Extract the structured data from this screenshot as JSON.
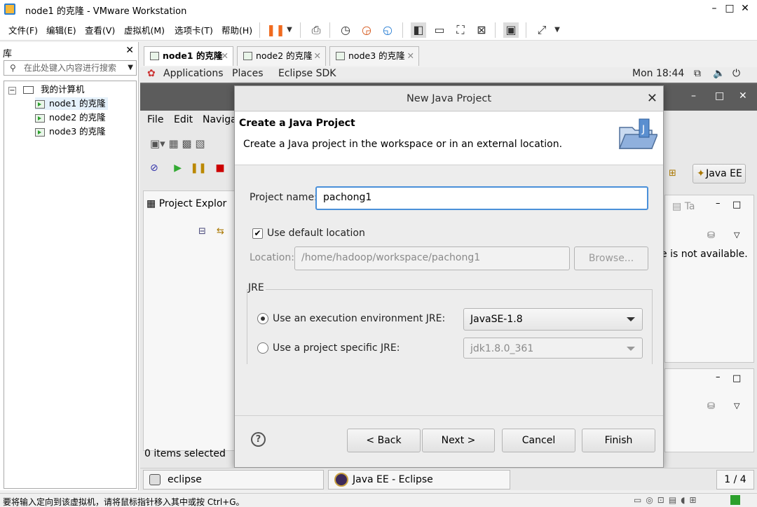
{
  "window": {
    "title": "node1 的克隆 - VMware Workstation",
    "controls": [
      "–",
      "□",
      "✕"
    ]
  },
  "menubar": {
    "items": [
      "文件(F)",
      "编辑(E)",
      "查看(V)",
      "虚拟机(M)",
      "选项卡(T)",
      "帮助(H)"
    ]
  },
  "library": {
    "title": "库",
    "close": "✕",
    "search_placeholder": "在此处键入内容进行搜索",
    "tree": {
      "root": "我的计算机",
      "items": [
        "node1 的克隆",
        "node2 的克隆",
        "node3 的克隆"
      ]
    }
  },
  "vm_tabs": [
    {
      "label": "node1 的克隆",
      "active": true
    },
    {
      "label": "node2 的克隆",
      "active": false
    },
    {
      "label": "node3 的克隆",
      "active": false
    }
  ],
  "gnome": {
    "applications": "Applications",
    "places": "Places",
    "eclipse_sdk": "Eclipse SDK",
    "clock": "Mon 18:44"
  },
  "eclipse": {
    "menu": [
      "File",
      "Edit",
      "Navigat"
    ],
    "project_explorer": "Project Explor",
    "perspective": "Java EE",
    "task_tab": "Ta",
    "not_available": "e is not available.",
    "status": "0 items selected"
  },
  "dialog": {
    "title": "New Java Project",
    "header_title": "Create a Java Project",
    "header_desc": "Create a Java project in the workspace or in an external location.",
    "project_name_label": "Project name:",
    "project_name_value": "pachong1",
    "use_default_label": "Use default location",
    "use_default_checked": true,
    "location_label": "Location:",
    "location_value": "/home/hadoop/workspace/pachong1",
    "browse_label": "Browse...",
    "jre_group": "JRE",
    "jre_exec_env_label": "Use an execution environment JRE:",
    "jre_exec_env_value": "JavaSE-1.8",
    "jre_specific_label": "Use a project specific JRE:",
    "jre_specific_value": "jdk1.8.0_361",
    "help": "?",
    "back": "< Back",
    "next": "Next >",
    "cancel": "Cancel",
    "finish": "Finish"
  },
  "guest_taskbar": {
    "items": [
      "eclipse",
      "Java EE - Eclipse"
    ],
    "workspace": "1 / 4"
  },
  "statusbar": {
    "message": "要将输入定向到该虚拟机，请将鼠标指针移入其中或按 Ctrl+G。"
  },
  "colors": {
    "accent": "#4a90d9",
    "pause": "#f06a1e",
    "vm_run": "#2ca02c"
  }
}
